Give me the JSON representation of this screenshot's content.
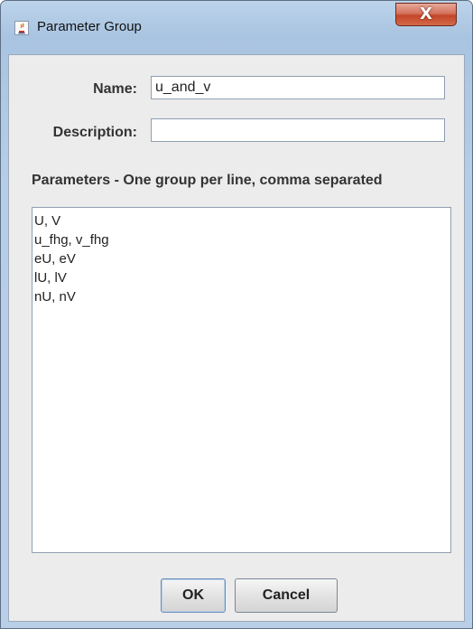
{
  "window": {
    "title": "Parameter Group",
    "icon": "java-cup-icon",
    "close_label": "X"
  },
  "form": {
    "name_label": "Name:",
    "name_value": "u_and_v",
    "description_label": "Description:",
    "description_value": "",
    "params_heading": "Parameters - One group per line, comma separated",
    "params_lines": [
      "U, V",
      "u_fhg, v_fhg",
      "eU, eV",
      "lU, lV",
      "nU, nV"
    ]
  },
  "buttons": {
    "ok_label": "OK",
    "cancel_label": "Cancel"
  }
}
